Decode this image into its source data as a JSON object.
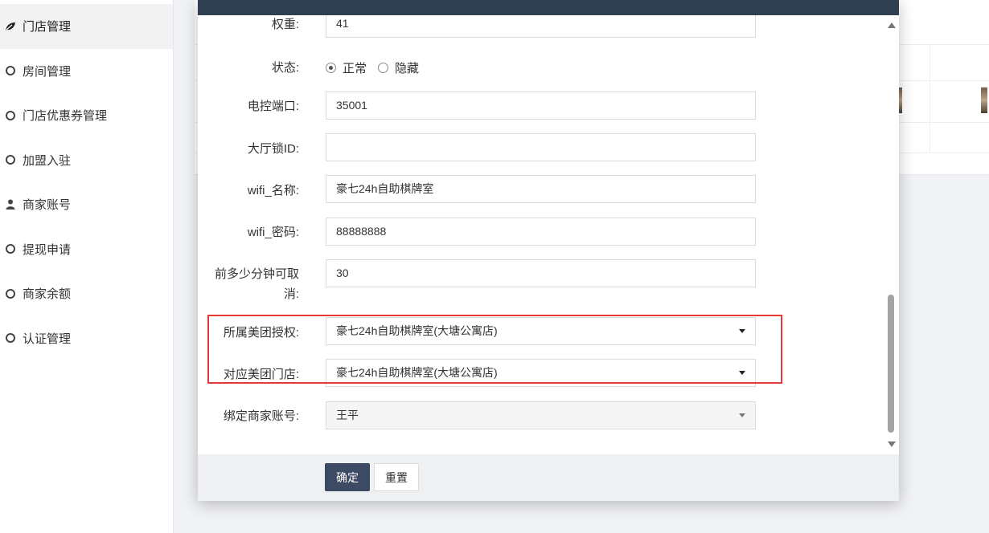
{
  "sidebar": {
    "items": [
      {
        "label": "门店管理",
        "icon": "leaf-icon",
        "active": true
      },
      {
        "label": "房间管理",
        "icon": "circle-icon"
      },
      {
        "label": "门店优惠券管理",
        "icon": "circle-icon"
      },
      {
        "label": "加盟入驻",
        "icon": "circle-icon"
      },
      {
        "label": "商家账号",
        "icon": "user-icon"
      },
      {
        "label": "提现申请",
        "icon": "circle-icon"
      },
      {
        "label": "商家余额",
        "icon": "circle-icon"
      },
      {
        "label": "认证管理",
        "icon": "circle-icon"
      }
    ]
  },
  "form": {
    "weight": {
      "label": "权重:",
      "value": "41"
    },
    "status": {
      "label": "状态:",
      "options": [
        "正常",
        "隐藏"
      ],
      "selected": "正常"
    },
    "port": {
      "label": "电控端口:",
      "value": "35001"
    },
    "lobby_lock": {
      "label": "大厅锁ID:",
      "value": ""
    },
    "wifi_name": {
      "label": "wifi_名称:",
      "value": "豪七24h自助棋牌室"
    },
    "wifi_pwd": {
      "label": "wifi_密码:",
      "value": "88888888"
    },
    "cancel_minutes": {
      "label_line1": "前多少分钟可取",
      "label_line2": "消:",
      "value": "30"
    },
    "meituan_auth": {
      "label": "所属美团授权:",
      "value": "豪七24h自助棋牌室(大塘公寓店)"
    },
    "meituan_store": {
      "label": "对应美团门店:",
      "value": "豪七24h自助棋牌室(大塘公寓店)"
    },
    "merchant": {
      "label": "绑定商家账号:",
      "value": "王平"
    }
  },
  "footer": {
    "confirm": "确定",
    "reset": "重置"
  },
  "colors": {
    "primary_button": "#3c4a63",
    "modal_header": "#2f3e50",
    "highlight": "#e53935"
  }
}
